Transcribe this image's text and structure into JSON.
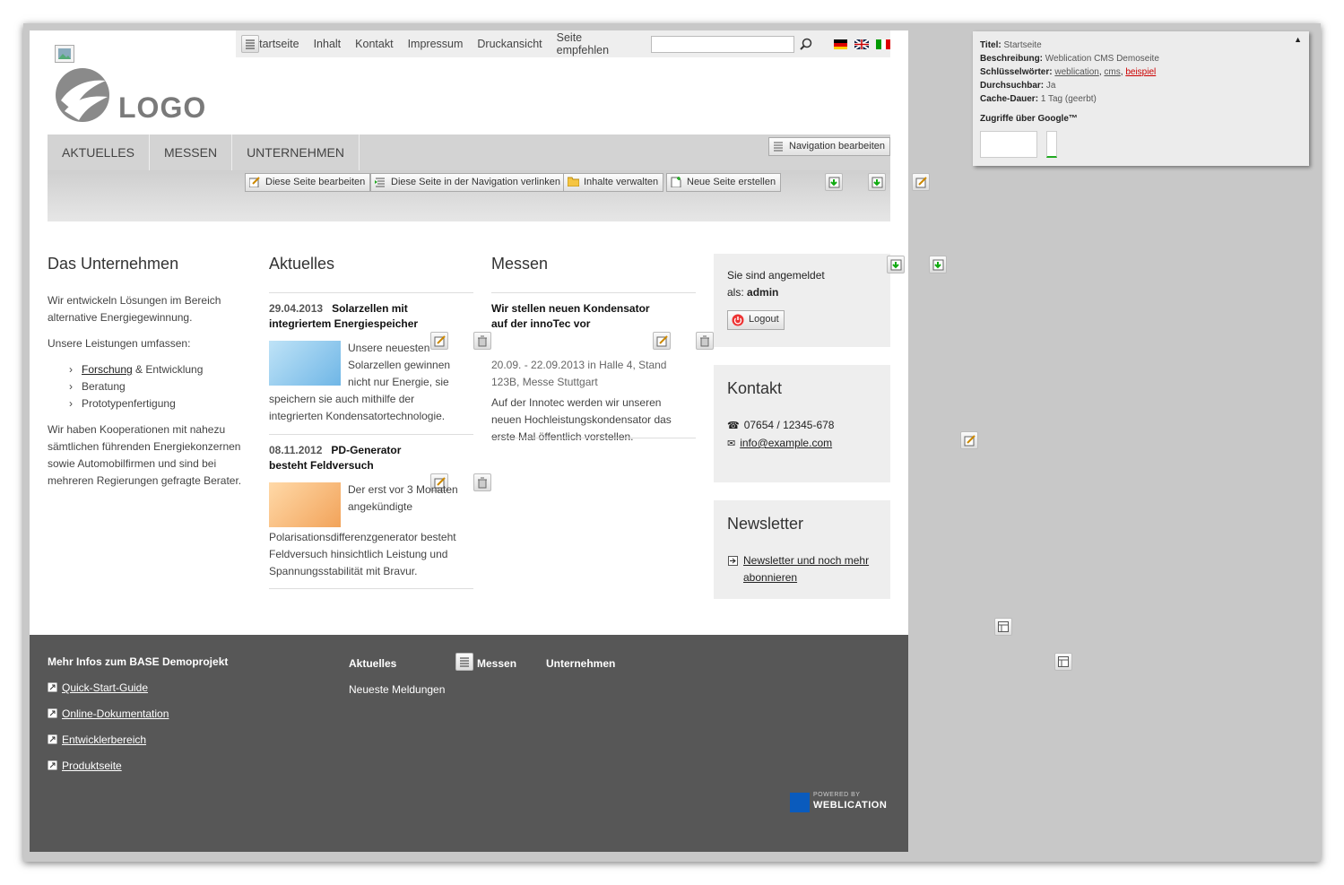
{
  "topnav": {
    "items": [
      "Startseite",
      "Inhalt",
      "Kontakt",
      "Impressum",
      "Druckansicht",
      "Seite empfehlen"
    ],
    "search_placeholder": ""
  },
  "logo": {
    "text": "LOGO"
  },
  "mainnav": {
    "items": [
      "AKTUELLES",
      "MESSEN",
      "UNTERNEHMEN"
    ],
    "edit_nav": "Navigation bearbeiten"
  },
  "toolbar": {
    "edit_page": "Diese Seite bearbeiten",
    "link_nav": "Diese Seite in der Navigation verlinken",
    "manage": "Inhalte verwalten",
    "new_page": "Neue Seite erstellen"
  },
  "col1": {
    "title": "Das Unternehmen",
    "p1": "Wir entwickeln Lösungen im Bereich alternative Energiegewinnung.",
    "p2": "Unsere Leistungen umfassen:",
    "list": [
      {
        "link": "Forschung",
        "rest": " & Entwicklung"
      },
      {
        "link": "",
        "rest": "Beratung"
      },
      {
        "link": "",
        "rest": "Prototypenfertigung"
      }
    ],
    "p3": "Wir haben Kooperationen mit nahezu sämtlichen führenden Energiekonzernen sowie Automobilfirmen und sind bei mehreren Regierungen gefragte Berater."
  },
  "col2": {
    "title": "Aktuelles",
    "items": [
      {
        "date": "29.04.2013",
        "title": "Solarzellen mit integriertem Energiespeicher",
        "text_side": "Unsere neuesten Solarzellen gewinnen nicht nur Energie, sie",
        "text_rest": "speichern sie auch mithilfe der integrierten Kondensatortechnologie."
      },
      {
        "date": "08.11.2012",
        "title": "PD-Generator besteht Feldversuch",
        "text_side": "Der erst vor 3 Monaten angekündigte",
        "text_rest": "Polarisationsdifferenzgenerator besteht Feldversuch hinsichtlich Leistung und Spannungsstabilität mit Bravur."
      }
    ]
  },
  "col3": {
    "title": "Messen",
    "item": {
      "title": "Wir stellen neuen Kondensator auf der innoTec vor",
      "meta": "20.09. - 22.09.2013 in Halle 4, Stand 123B, Messe Stuttgart",
      "text": "Auf der Innotec werden wir unseren neuen Hochleistungskondensator das erste Mal öffentlich vorstellen."
    }
  },
  "login": {
    "line1": "Sie sind angemeldet",
    "prefix": "als: ",
    "user": "admin",
    "logout": "Logout"
  },
  "contact": {
    "title": "Kontakt",
    "phone": "07654 / 12345-678",
    "email": "info@example.com"
  },
  "newsletter": {
    "title": "Newsletter",
    "link": "Newsletter und noch mehr abonnieren"
  },
  "footer": {
    "title": "Mehr Infos zum BASE Demoprojekt",
    "links": [
      "Quick-Start-Guide",
      "Online-Dokumentation",
      "Entwicklerbereich",
      "Produktseite"
    ],
    "cols": [
      "Aktuelles",
      "Messen",
      "Unternehmen"
    ],
    "sub": "Neueste Meldungen",
    "powered": "POWERED BY",
    "brand": "WEBLICATION"
  },
  "info": {
    "title_label": "Titel:",
    "title_value": "Startseite",
    "desc_label": "Beschreibung:",
    "desc_value": "Weblication CMS Demoseite",
    "kw_label": "Schlüsselwörter:",
    "kw": [
      "weblication",
      "cms",
      "beispiel"
    ],
    "search_label": "Durchsuchbar:",
    "search_value": "Ja",
    "cache_label": "Cache-Dauer:",
    "cache_value": "1 Tag (geerbt)",
    "google": "Zugriffe über Google™"
  },
  "colors": {
    "footer": "#575757",
    "nav": "#d3d3d3",
    "keyword_red": "#cc0000"
  }
}
